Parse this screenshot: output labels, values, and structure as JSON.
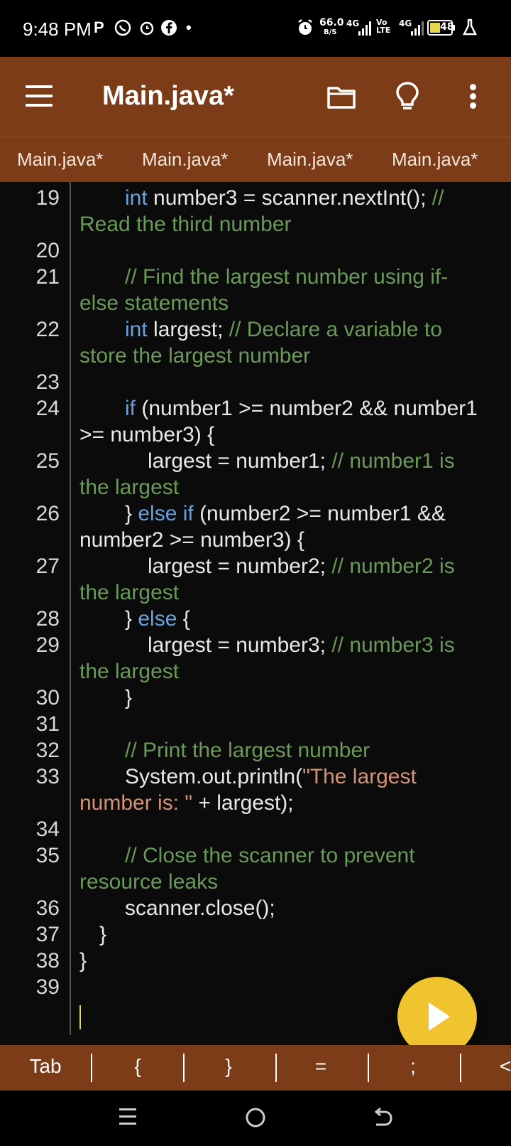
{
  "status_bar": {
    "time": "9:48 PM",
    "icons": [
      "p-icon",
      "whatsapp-icon",
      "alarm-icon",
      "facebook-icon",
      "dot-icon"
    ],
    "speed_value": "66.0",
    "speed_unit": "B/S",
    "network_left": "4G",
    "volte": "Vo LTE",
    "network_right": "4G",
    "battery": "48"
  },
  "app_bar": {
    "title": "Main.java*"
  },
  "tabs": [
    "Main.java*",
    "Main.java*",
    "Main.java*",
    "Main.java*"
  ],
  "editor": {
    "lines": [
      {
        "n": "19"
      },
      {
        "n": "20"
      },
      {
        "n": "21"
      },
      {
        "n": "22"
      },
      {
        "n": "23"
      },
      {
        "n": "24"
      },
      {
        "n": "25"
      },
      {
        "n": "26"
      },
      {
        "n": "27"
      },
      {
        "n": "28"
      },
      {
        "n": "29"
      },
      {
        "n": "30"
      },
      {
        "n": "31"
      },
      {
        "n": "32"
      },
      {
        "n": "33"
      },
      {
        "n": "34"
      },
      {
        "n": "35"
      },
      {
        "n": "36"
      },
      {
        "n": "37"
      },
      {
        "n": "38"
      },
      {
        "n": "39"
      }
    ],
    "code": {
      "l19a_kw": "int",
      "l19a": " number3 = scanner.nextInt(); ",
      "l19a_cm": "//",
      "l19b_cm": "Read the third number",
      "l21a_cm": "// Find the largest number using if-",
      "l21b_cm": "else statements",
      "l22a_kw": "int",
      "l22a": " largest; ",
      "l22a_cm": "// Declare a variable to",
      "l22b_cm": "store the largest number",
      "l24a_kw": "if",
      "l24a": " (number1 >= number2 && number1",
      "l24b": ">= number3) {",
      "l25a": "largest = number1; ",
      "l25a_cm": "// number1 is",
      "l25b_cm": "the largest",
      "l26a": "} ",
      "l26a_kw": "else if",
      "l26a2": " (number2 >= number1 &&",
      "l26b": "number2 >= number3) {",
      "l27a": "largest = number2; ",
      "l27a_cm": "// number2 is",
      "l27b_cm": "the largest",
      "l28a": "} ",
      "l28a_kw": "else",
      "l28a2": " {",
      "l29a": "largest = number3; ",
      "l29a_cm": "// number3 is",
      "l29b_cm": "the largest",
      "l30": "}",
      "l32_cm": "// Print the largest number",
      "l33a": "System.out.println(",
      "l33a_str": "\"The largest",
      "l33b_str": "number is: \"",
      "l33b": " + largest);",
      "l35a_cm": "// Close the scanner to prevent",
      "l35b_cm": "resource leaks",
      "l36": "scanner.close();",
      "l37": "}",
      "l38": "}"
    }
  },
  "symbol_bar": [
    "Tab",
    "{",
    "}",
    "=",
    ";",
    "<"
  ],
  "colors": {
    "primary": "#7b3c17",
    "fab": "#efc42f",
    "keyword": "#6aa0de",
    "comment": "#6a9a5a",
    "string": "#d59279"
  }
}
